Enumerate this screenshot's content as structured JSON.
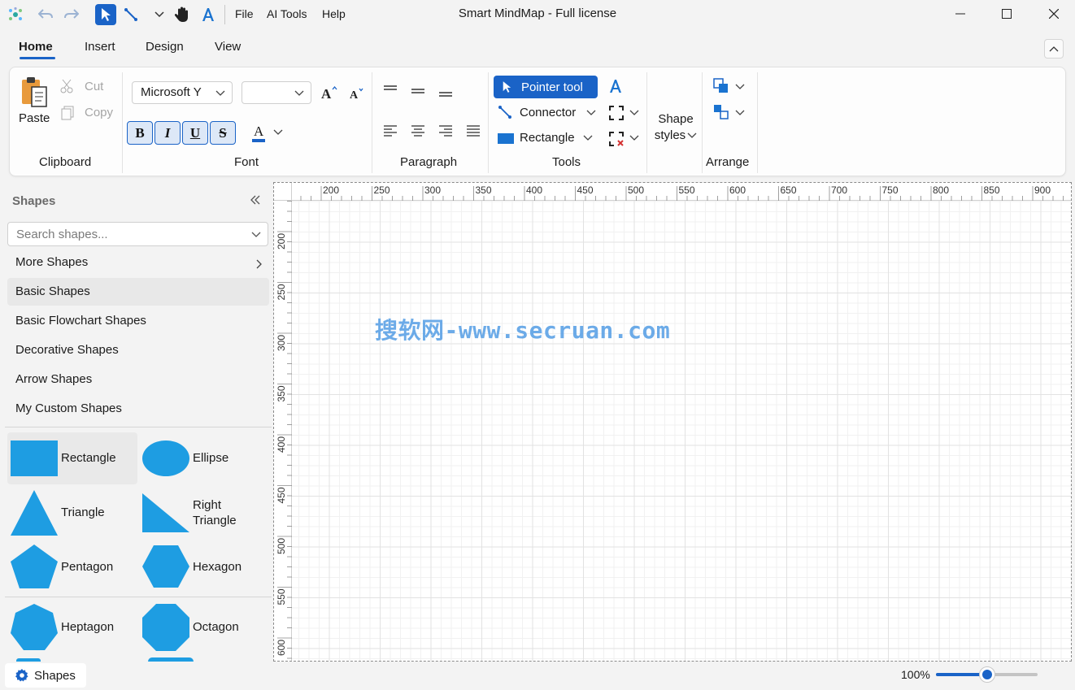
{
  "window": {
    "title": "Smart MindMap - Full license",
    "menu": [
      "File",
      "AI Tools",
      "Help"
    ]
  },
  "ribbon_tabs": [
    "Home",
    "Insert",
    "Design",
    "View"
  ],
  "clipboard": {
    "paste": "Paste",
    "cut": "Cut",
    "copy": "Copy",
    "label": "Clipboard"
  },
  "font": {
    "family": "Microsoft Y",
    "size": "",
    "bold": "B",
    "italic": "I",
    "underline": "U",
    "strike": "S",
    "color_letter": "A",
    "label": "Font"
  },
  "paragraph": {
    "label": "Paragraph"
  },
  "tools": {
    "pointer": "Pointer tool",
    "connector": "Connector",
    "rectangle": "Rectangle",
    "label": "Tools"
  },
  "shape_styles": {
    "line1": "Shape",
    "line2": "styles"
  },
  "arrange": {
    "label": "Arrange"
  },
  "panel": {
    "title": "Shapes",
    "search_placeholder": "Search shapes...",
    "categories": [
      "More Shapes",
      "Basic Shapes",
      "Basic Flowchart Shapes",
      "Decorative Shapes",
      "Arrow Shapes",
      "My Custom Shapes"
    ],
    "selected_category": "Basic Shapes",
    "shapes": [
      "Rectangle",
      "Ellipse",
      "Triangle",
      "Right Triangle",
      "Pentagon",
      "Hexagon",
      "Heptagon",
      "Octagon"
    ],
    "shape_color": "#1e9de2"
  },
  "ruler": {
    "top_ticks": [
      "200",
      "250",
      "300",
      "350",
      "400",
      "450",
      "500",
      "550",
      "600",
      "650",
      "700",
      "750",
      "800",
      "850",
      "900"
    ],
    "left_ticks": [
      "200",
      "250",
      "300",
      "350",
      "400",
      "450",
      "500",
      "550",
      "600"
    ]
  },
  "watermark": "搜软网-www.secruan.com",
  "status": {
    "tab": "Shapes",
    "zoom": "100%",
    "zoom_level": 0.5
  },
  "colors": {
    "accent": "#1a63c7",
    "shape": "#1e9de2"
  }
}
